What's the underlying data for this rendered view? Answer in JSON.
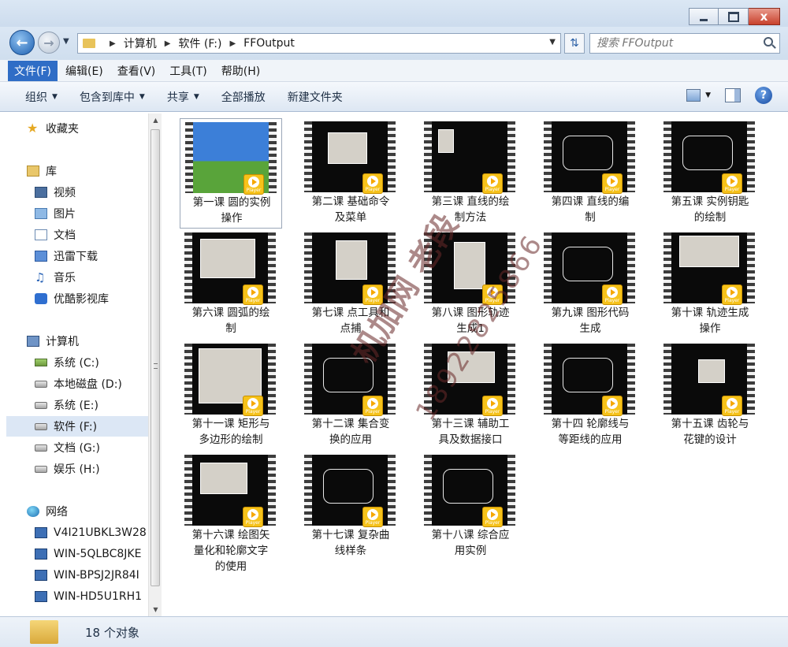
{
  "window": {
    "controls": {
      "close_glyph": "x"
    }
  },
  "address": {
    "crumbs": [
      "计算机",
      "软件 (F:)",
      "FFOutput"
    ]
  },
  "search": {
    "placeholder": "搜索 FFOutput"
  },
  "menu": [
    "文件(F)",
    "编辑(E)",
    "查看(V)",
    "工具(T)",
    "帮助(H)"
  ],
  "commands": {
    "organize": "组织",
    "include_library": "包含到库中",
    "share": "共享",
    "play_all": "全部播放",
    "new_folder": "新建文件夹"
  },
  "sidebar": {
    "favorites": "收藏夹",
    "libraries": "库",
    "lib_items": [
      "视频",
      "图片",
      "文档",
      "迅雷下载",
      "音乐",
      "优酷影视库"
    ],
    "computer": "计算机",
    "drives": [
      "系统 (C:)",
      "本地磁盘 (D:)",
      "系统 (E:)",
      "软件 (F:)",
      "文档 (G:)",
      "娱乐 (H:)"
    ],
    "network": "网络",
    "hosts": [
      "V4I21UBKL3W28",
      "WIN-5QLBC8JKE",
      "WIN-BPSJ2JR84I",
      "WIN-HD5U1RH1"
    ]
  },
  "files": [
    {
      "line1": "第一课  圆的实例",
      "line2": "操作",
      "line3": ""
    },
    {
      "line1": "第二课 基础命令",
      "line2": "及菜单",
      "line3": ""
    },
    {
      "line1": "第三课 直线的绘",
      "line2": "制方法",
      "line3": ""
    },
    {
      "line1": "第四课 直线的编",
      "line2": "制",
      "line3": ""
    },
    {
      "line1": "第五课 实例钥匙",
      "line2": "的绘制",
      "line3": ""
    },
    {
      "line1": "第六课 圆弧的绘",
      "line2": "制",
      "line3": ""
    },
    {
      "line1": "第七课 点工具和",
      "line2": "点捕",
      "line3": ""
    },
    {
      "line1": "第八课 图形轨迹",
      "line2": "生成1",
      "line3": ""
    },
    {
      "line1": "第九课 图形代码",
      "line2": "生成",
      "line3": ""
    },
    {
      "line1": "第十课 轨迹生成",
      "line2": "操作",
      "line3": ""
    },
    {
      "line1": "第十一课 矩形与",
      "line2": "多边形的绘制",
      "line3": ""
    },
    {
      "line1": "第十二课 集合变",
      "line2": "换的应用",
      "line3": ""
    },
    {
      "line1": "第十三课 辅助工",
      "line2": "具及数据接口",
      "line3": ""
    },
    {
      "line1": "第十四 轮廓线与",
      "line2": "等距线的应用",
      "line3": ""
    },
    {
      "line1": "第十五课 齿轮与",
      "line2": "花键的设计",
      "line3": ""
    },
    {
      "line1": "第十六课 绘图矢",
      "line2": "量化和轮廓文字",
      "line3": "的使用"
    },
    {
      "line1": "第十七课 复杂曲",
      "line2": "线样条",
      "line3": ""
    },
    {
      "line1": "第十八课 综合应",
      "line2": "用实例",
      "line3": ""
    }
  ],
  "player_badge": "Player",
  "watermark": {
    "line1": "机加网 老段",
    "line2": "18922825866"
  },
  "status": {
    "count_text": "18 个对象"
  },
  "colors": {
    "menu_active": "#2f6dc6",
    "badge": "#f6c21a",
    "close_button": "#c8412c"
  }
}
